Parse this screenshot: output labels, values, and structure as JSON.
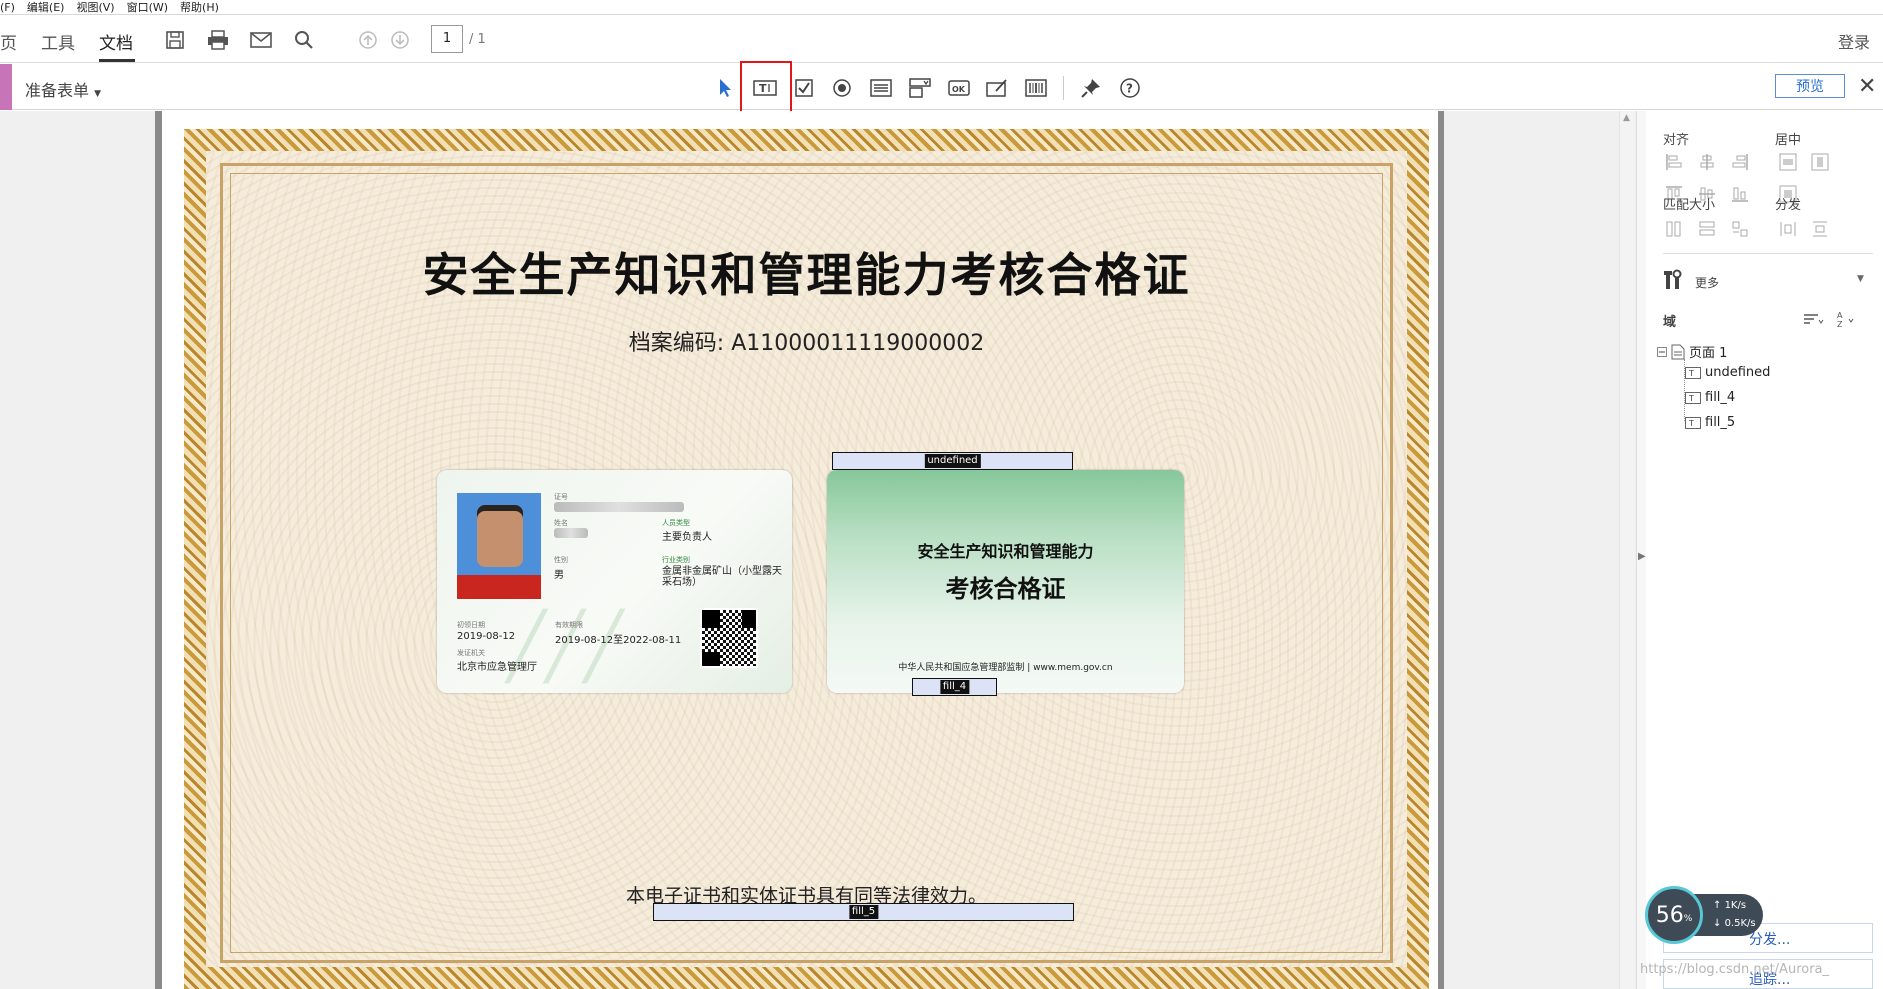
{
  "menu": {
    "items": [
      "(F)",
      "编辑(E)",
      "视图(V)",
      "窗口(W)",
      "帮助(H)"
    ]
  },
  "toolbar": {
    "tabs": [
      "页",
      "工具",
      "文档"
    ],
    "active_tab": "文档",
    "icons": [
      "save-icon",
      "print-icon",
      "mail-icon",
      "search-icon",
      "page-up-icon",
      "page-down-icon"
    ],
    "page_current": "1",
    "page_total": "/ 1",
    "login": "登录"
  },
  "formbar": {
    "prepare_label": "准备表单",
    "tools": [
      "select-arrow-icon",
      "text-field-icon",
      "checkbox-icon",
      "radio-button-icon",
      "list-box-icon",
      "dropdown-icon",
      "button-ok-icon",
      "signature-icon",
      "barcode-icon",
      "pin-icon",
      "help-icon"
    ],
    "preview": "预览"
  },
  "certificate": {
    "title": "安全生产知识和管理能力考核合格证",
    "archive_no": "档案编码: A11000011119000002",
    "legal_text": "本电子证书和实体证书具有同等法律效力。",
    "front": {
      "id_label": "证号",
      "name_label": "姓名",
      "person_type_label": "人员类型",
      "person_type": "主要负责人",
      "gender_label": "性别",
      "gender": "男",
      "industry_label": "行业类别",
      "industry": "金属非金属矿山（小型露天采石场）",
      "first_issue_label": "初领日期",
      "first_issue": "2019-08-12",
      "valid_label": "有效期限",
      "valid": "2019-08-12至2022-08-11",
      "authority_label": "发证机关",
      "authority": "北京市应急管理厅"
    },
    "back": {
      "line1": "安全生产知识和管理能力",
      "line2": "考核合格证",
      "footer": "中华人民共和国应急管理部监制 | www.mem.gov.cn"
    }
  },
  "fields": [
    {
      "name": "undefined"
    },
    {
      "name": "fill_4"
    },
    {
      "name": "fill_5"
    }
  ],
  "rpanel": {
    "align": "对齐",
    "center": "居中",
    "match_size": "匹配大小",
    "distribute": "分发",
    "more": "更多",
    "fields_label": "域",
    "tree_root": "页面 1",
    "tree_items": [
      "undefined",
      "fill_4",
      "fill_5"
    ],
    "link1": "分发...",
    "link2": "追踪..."
  },
  "speed": {
    "percent": "56",
    "percent_unit": "%",
    "up": "1K/s",
    "down": "0.5K/s"
  },
  "watermark": "https://blog.csdn.net/Aurora_"
}
